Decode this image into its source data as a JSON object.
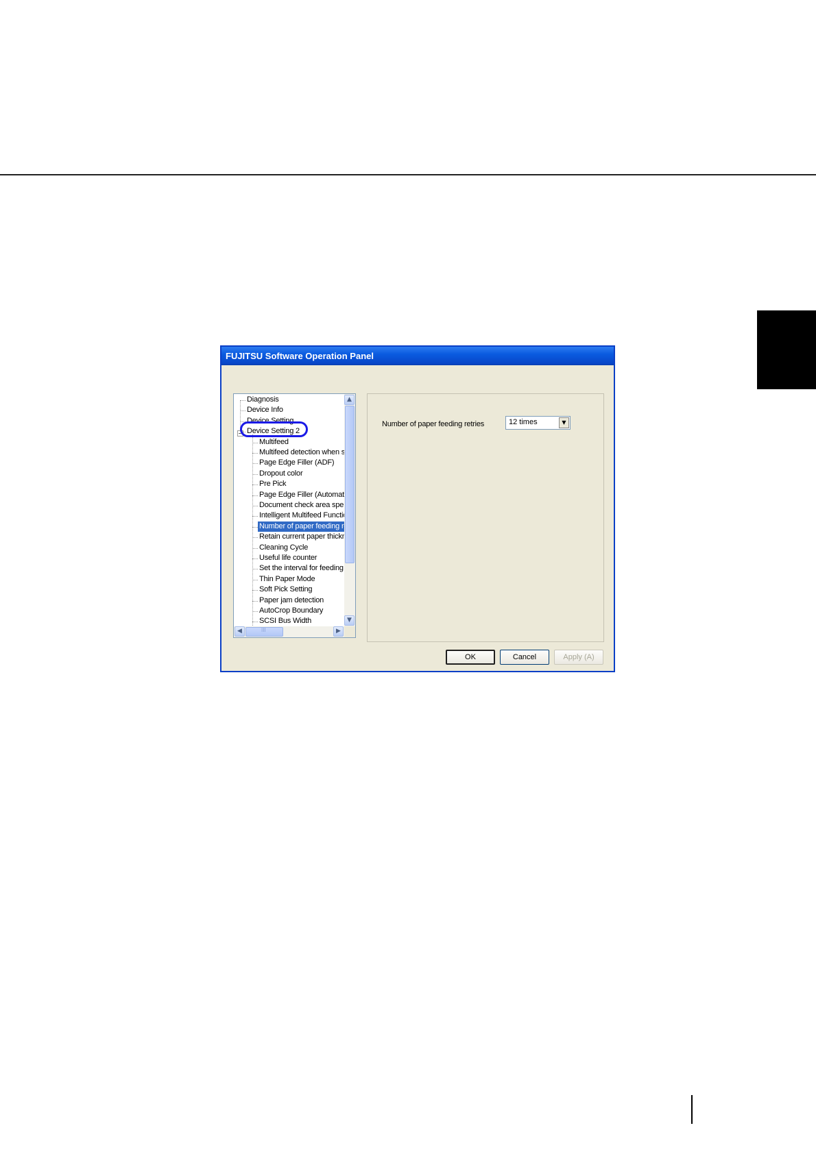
{
  "window": {
    "title": "FUJITSU Software Operation Panel"
  },
  "tree": {
    "items": [
      {
        "label": "Diagnosis",
        "level": 0,
        "selected": false
      },
      {
        "label": "Device Info",
        "level": 0,
        "selected": false
      },
      {
        "label": "Device Setting",
        "level": 0,
        "selected": false
      },
      {
        "label": "Device Setting 2",
        "level": 0,
        "selected": false,
        "expanded": true,
        "highlighted": true
      },
      {
        "label": "Multifeed",
        "level": 1,
        "selected": false
      },
      {
        "label": "Multifeed detection when s",
        "level": 1,
        "selected": false
      },
      {
        "label": "Page Edge Filler (ADF)",
        "level": 1,
        "selected": false
      },
      {
        "label": "Dropout color",
        "level": 1,
        "selected": false
      },
      {
        "label": "Pre Pick",
        "level": 1,
        "selected": false
      },
      {
        "label": "Page Edge Filler (Automatic",
        "level": 1,
        "selected": false
      },
      {
        "label": "Document check area spe",
        "level": 1,
        "selected": false
      },
      {
        "label": "Intelligent Multifeed Functio",
        "level": 1,
        "selected": false
      },
      {
        "label": "Number of paper feeding re",
        "level": 1,
        "selected": true
      },
      {
        "label": "Retain current paper thickn",
        "level": 1,
        "selected": false
      },
      {
        "label": "Cleaning Cycle",
        "level": 1,
        "selected": false
      },
      {
        "label": "Useful life counter",
        "level": 1,
        "selected": false
      },
      {
        "label": "Set the interval for feeding",
        "level": 1,
        "selected": false
      },
      {
        "label": "Thin Paper Mode",
        "level": 1,
        "selected": false
      },
      {
        "label": "Soft Pick Setting",
        "level": 1,
        "selected": false
      },
      {
        "label": "Paper jam detection",
        "level": 1,
        "selected": false
      },
      {
        "label": "AutoCrop Boundary",
        "level": 1,
        "selected": false
      },
      {
        "label": "SCSI Bus Width",
        "level": 1,
        "selected": false
      }
    ],
    "hscroll_thumb_text": "III"
  },
  "settings": {
    "paper_feeding_retries_label": "Number of paper feeding retries",
    "paper_feeding_retries_value": "12 times"
  },
  "buttons": {
    "ok": "OK",
    "cancel": "Cancel",
    "apply": "Apply (A)"
  },
  "colors": {
    "titlebar": "#0a5be0",
    "selection": "#316ac5",
    "highlight_oval": "#1a1ae6",
    "dialog_bg": "#ece9d8"
  }
}
